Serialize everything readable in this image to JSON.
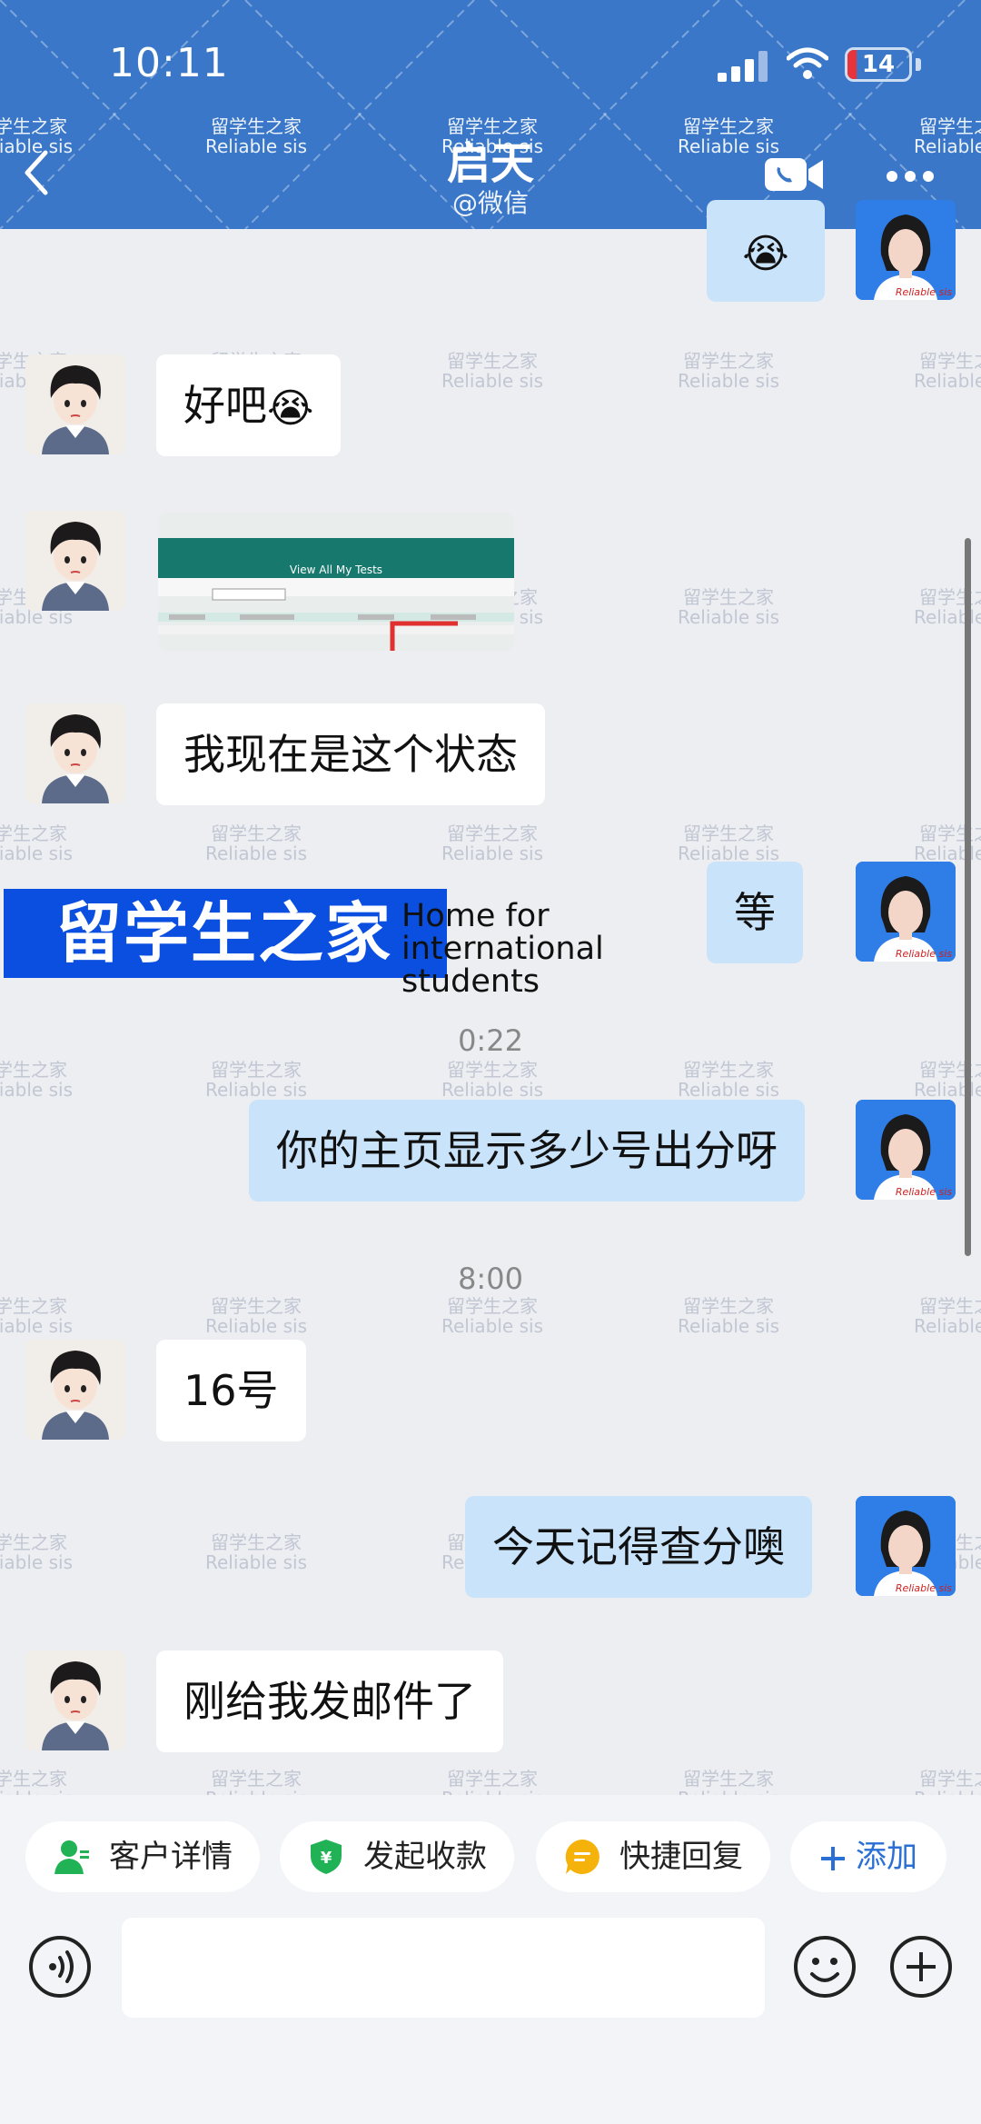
{
  "status_bar": {
    "time": "10:11",
    "battery": "14",
    "battery_level_percent": 14
  },
  "header": {
    "title": "启天",
    "subtitle": "@微信"
  },
  "watermark": {
    "line1": "留学生之家",
    "line2": "Reliable sis"
  },
  "messages": [
    {
      "side": "right",
      "type": "emoji",
      "emoji": "😭"
    },
    {
      "side": "left",
      "type": "text",
      "text": "好吧",
      "emoji": "😭"
    },
    {
      "side": "left",
      "type": "image",
      "caption": "View All My Tests"
    },
    {
      "side": "left",
      "type": "text",
      "text": "我现在是这个状态"
    },
    {
      "side": "right",
      "type": "text",
      "text": "等"
    },
    {
      "side": "right",
      "type": "text",
      "text": "你的主页显示多少号出分呀"
    },
    {
      "side": "left",
      "type": "text",
      "text": "16号"
    },
    {
      "side": "right",
      "type": "text",
      "text": "今天记得查分噢"
    },
    {
      "side": "left",
      "type": "text",
      "text": "刚给我发邮件了"
    }
  ],
  "timestamps": [
    "0:22",
    "8:00"
  ],
  "avatar_badge": "Reliable sis",
  "banner": {
    "cn": "留学生之家",
    "en_line1": "Home for",
    "en_line2": "international",
    "en_line3": "students"
  },
  "quick_actions": [
    {
      "label": "客户详情",
      "icon": "person-icon",
      "color": "#20b255"
    },
    {
      "label": "发起收款",
      "icon": "payment-shield-icon",
      "color": "#20b255"
    },
    {
      "label": "快捷回复",
      "icon": "quick-reply-icon",
      "color": "#f5b20a"
    },
    {
      "label": "添加",
      "icon": "plus-icon",
      "color": "#2a6fd6"
    }
  ],
  "input": {
    "placeholder": ""
  },
  "colors": {
    "header": "#3a77c8",
    "bubble_right": "#c9e3fb",
    "bubble_left": "#ffffff",
    "banner": "#0a4fe0"
  }
}
